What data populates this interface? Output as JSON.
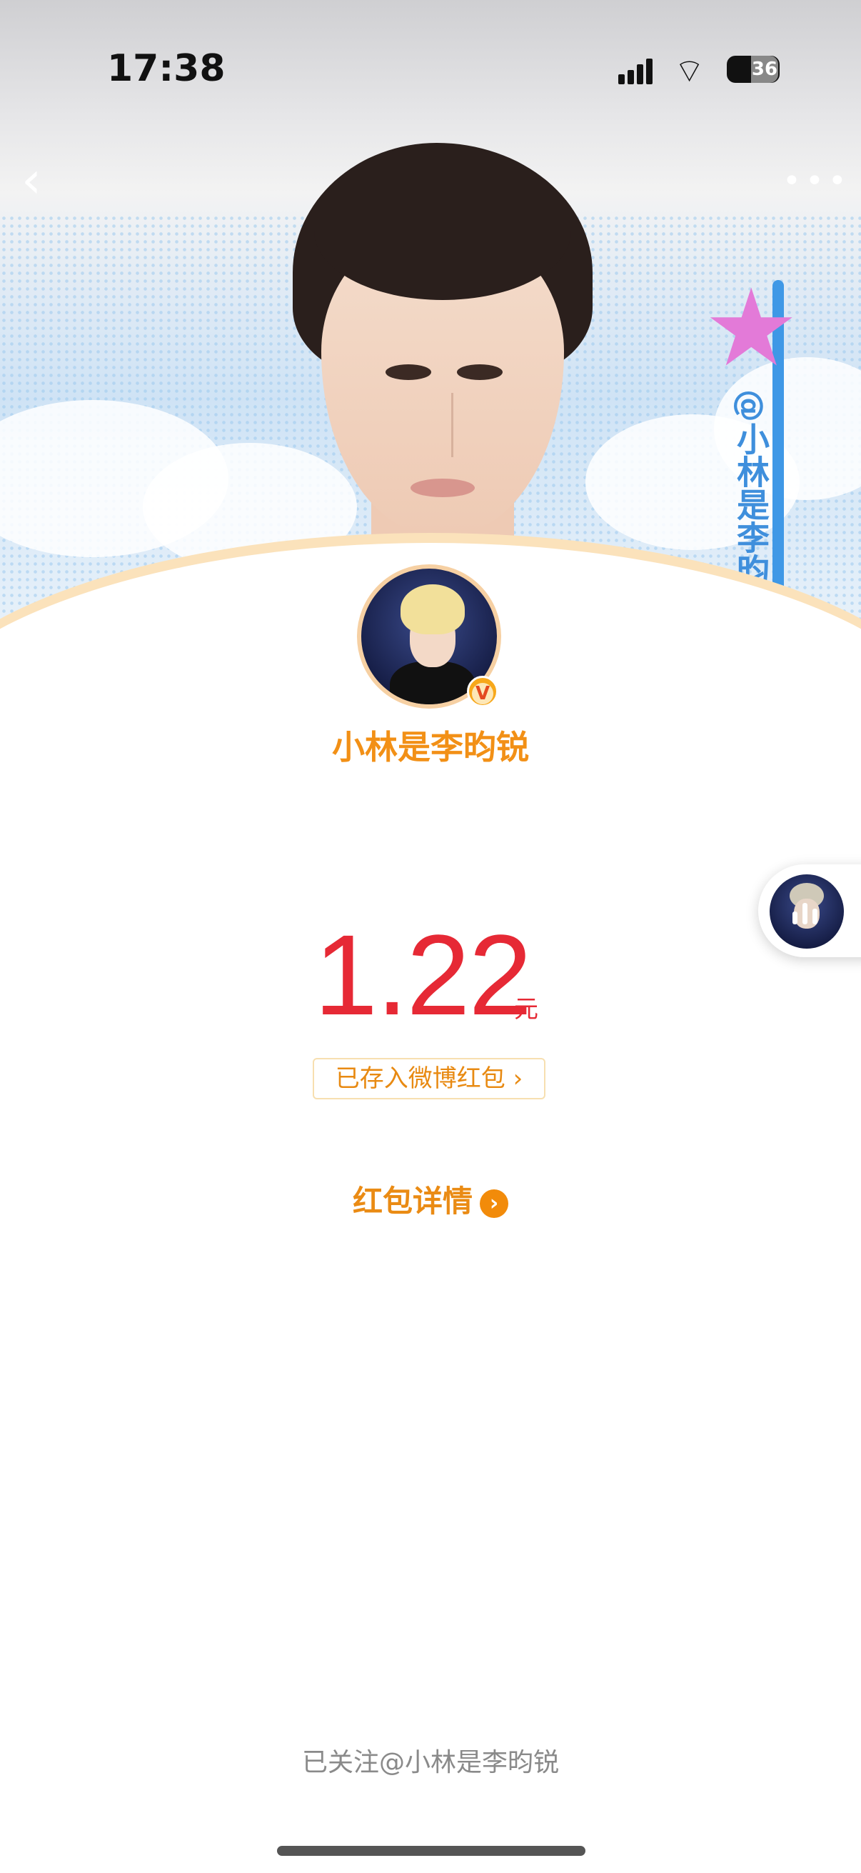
{
  "status_bar": {
    "time": "17:38",
    "battery": "36"
  },
  "banner": {
    "tag_text": "@小林是李昀锐"
  },
  "profile": {
    "username": "小林是李昀锐",
    "verified_badge": "V"
  },
  "red_packet": {
    "amount": "1.22",
    "unit": "元",
    "saved_label": "已存入微博红包 ›",
    "details_label": "红包详情",
    "details_arrow": "›"
  },
  "footer": {
    "followed_text": "已关注@小林是李昀锐"
  },
  "colors": {
    "accent_orange": "#f29016",
    "amount_red": "#e62935"
  }
}
